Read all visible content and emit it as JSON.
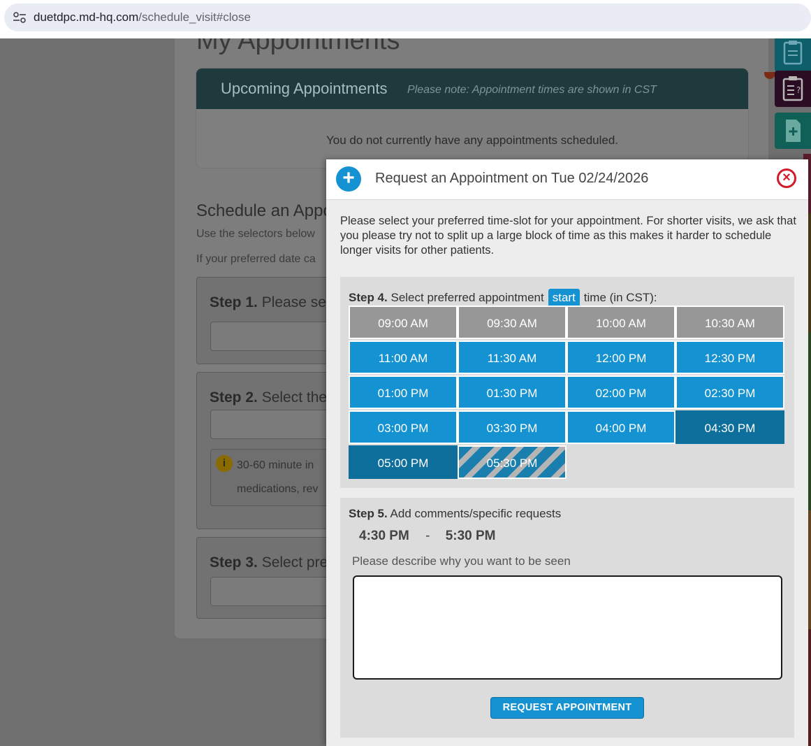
{
  "browser": {
    "url_domain": "duetdpc.md-hq.com",
    "url_path": "/schedule_visit#close",
    "site_icon": "tune-icon"
  },
  "background": {
    "page_title": "My Appointments",
    "upcoming": {
      "title": "Upcoming Appointments",
      "note": "Please note: Appointment times are shown in CST",
      "empty_message": "You do not currently have any appointments scheduled."
    },
    "schedule": {
      "title": "Schedule an Appo",
      "line1": "Use the selectors below",
      "line2": "If your preferred date ca"
    },
    "steps": [
      {
        "num": "Step 1.",
        "text": "Please sele"
      },
      {
        "num": "Step 2.",
        "text": "Select the"
      },
      {
        "num": "Step 3.",
        "text": "Select pref"
      }
    ],
    "info": {
      "icon": "info-icon",
      "line1": "30-60 minute in",
      "line2": "medications, rev"
    },
    "rail_icons": [
      "clipboard-icon",
      "clipboard-question-icon",
      "document-plus-icon"
    ],
    "rail_colors": [
      "#0e5f6a",
      "#2a0d22",
      "#106057"
    ]
  },
  "modal": {
    "title": "Request an Appointment on Tue 02/24/2026",
    "intro": "Please select your preferred time-slot for your appointment. For shorter visits, we ask that you please try not to split up a large block of time as this makes it harder to schedule longer visits for other patients.",
    "step4": {
      "num": "Step 4.",
      "text_before": "Select preferred appointment",
      "badge": "start",
      "text_after": "time (in CST):"
    },
    "slots": [
      {
        "label": "09:00 AM",
        "state": "past"
      },
      {
        "label": "09:30 AM",
        "state": "past"
      },
      {
        "label": "10:00 AM",
        "state": "past"
      },
      {
        "label": "10:30 AM",
        "state": "past"
      },
      {
        "label": "11:00 AM",
        "state": "open"
      },
      {
        "label": "11:30 AM",
        "state": "open"
      },
      {
        "label": "12:00 PM",
        "state": "open"
      },
      {
        "label": "12:30 PM",
        "state": "open"
      },
      {
        "label": "01:00 PM",
        "state": "open"
      },
      {
        "label": "01:30 PM",
        "state": "open"
      },
      {
        "label": "02:00 PM",
        "state": "open"
      },
      {
        "label": "02:30 PM",
        "state": "open"
      },
      {
        "label": "03:00 PM",
        "state": "open"
      },
      {
        "label": "03:30 PM",
        "state": "open"
      },
      {
        "label": "04:00 PM",
        "state": "open"
      },
      {
        "label": "04:30 PM",
        "state": "selected"
      },
      {
        "label": "05:00 PM",
        "state": "selected"
      },
      {
        "label": "05:30 PM",
        "state": "partial"
      }
    ],
    "step5": {
      "num": "Step 5.",
      "text": "Add comments/specific requests",
      "range_start": "4:30 PM",
      "range_sep": "-",
      "range_end": "5:30 PM",
      "describe_label": "Please describe why you want to be seen",
      "comment_value": ""
    },
    "submit_label": "REQUEST APPOINTMENT",
    "colors": {
      "accent": "#1592d1",
      "selected": "#0f6f9c",
      "past": "#979797",
      "close": "#d11a2a"
    }
  }
}
